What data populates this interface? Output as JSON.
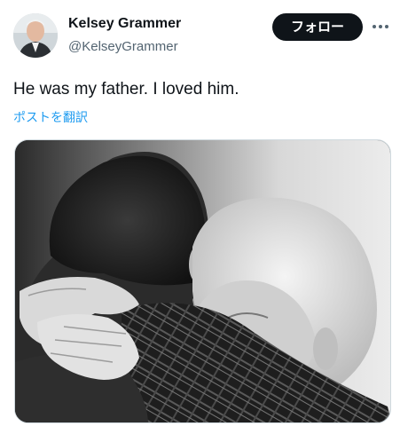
{
  "author": {
    "display_name": "Kelsey Grammer",
    "handle": "@KelseyGrammer",
    "avatar_icon": "profile-photo"
  },
  "actions": {
    "follow_label": "フォロー",
    "more_icon": "more-horizontal-icon"
  },
  "post": {
    "text": "He was my father. I loved him.",
    "translate_label": "ポストを翻訳"
  },
  "media": {
    "type": "black-and-white photograph",
    "colors": {
      "background": "#e6e6e6",
      "dark": "#1a1a1a"
    }
  },
  "colors": {
    "text_primary": "#0f1419",
    "text_secondary": "#536471",
    "link": "#1d9bf0",
    "button_bg": "#0f1419",
    "button_text": "#ffffff"
  }
}
